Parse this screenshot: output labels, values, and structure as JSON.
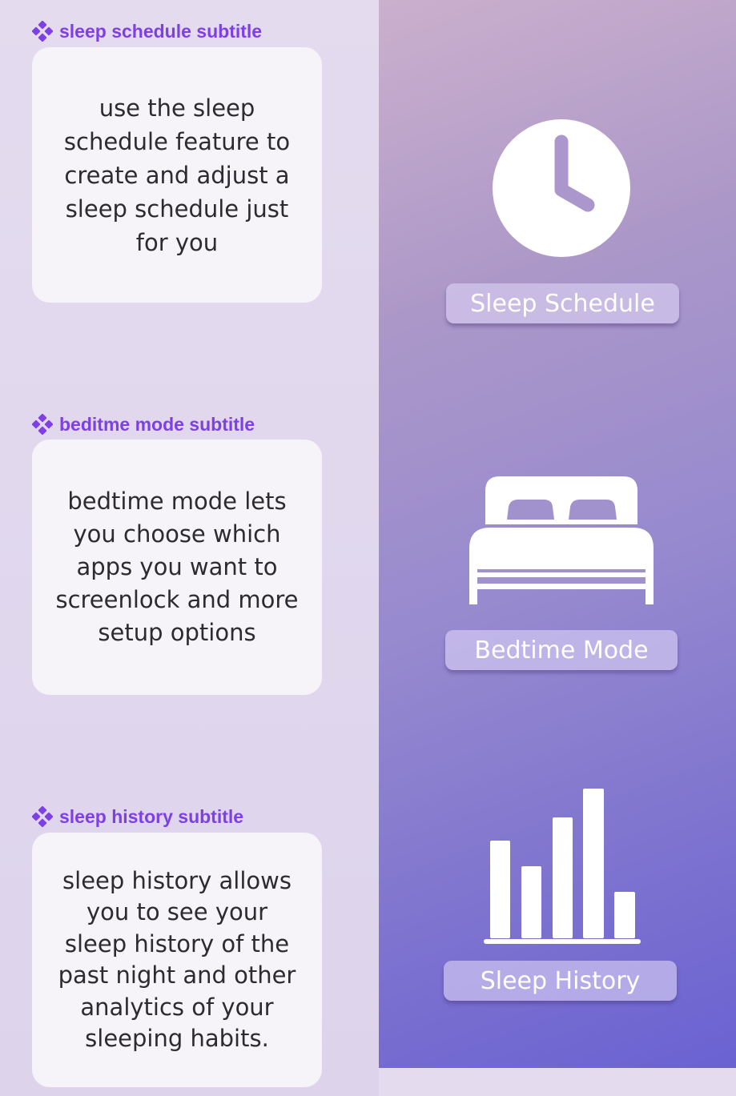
{
  "sections": [
    {
      "subtitle": "sleep schedule subtitle",
      "description": "use the sleep schedule feature to create and adjust a sleep schedule just for you",
      "icon": "clock-icon",
      "button_label": "Sleep Schedule"
    },
    {
      "subtitle": "beditme mode subtitle",
      "description": "bedtime mode lets you choose which apps you want to screenlock and more setup options",
      "icon": "bed-icon",
      "button_label": "Bedtime Mode"
    },
    {
      "subtitle": "sleep history subtitle",
      "description": "sleep history allows you to see your sleep history of the past night and other analytics of your sleeping habits.",
      "icon": "bar-chart-icon",
      "button_label": "Sleep History"
    }
  ],
  "colors": {
    "subtitle": "#7e3fe6",
    "card_background": "#f6f3f9",
    "panel_gradient_start": "#cbb0cd",
    "panel_gradient_end": "#6a62d2",
    "icon_fill": "#ffffff"
  },
  "icons": {
    "subtitle_marker": "component-diamond-icon"
  }
}
